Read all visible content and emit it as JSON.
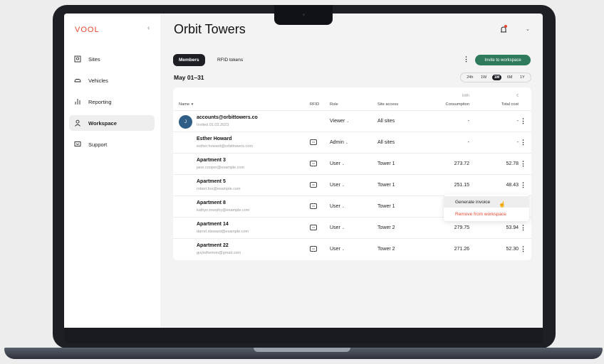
{
  "app": {
    "logo": "VOOL",
    "collapse_icon": "‹"
  },
  "sidebar": {
    "items": [
      {
        "label": "Sites",
        "icon": "map-pin-icon"
      },
      {
        "label": "Vehicles",
        "icon": "car-icon"
      },
      {
        "label": "Reporting",
        "icon": "bar-chart-icon"
      },
      {
        "label": "Workspace",
        "icon": "user-icon",
        "active": true
      },
      {
        "label": "Support",
        "icon": "chat-icon"
      }
    ]
  },
  "header": {
    "title": "Orbit Towers",
    "caret": "⌄"
  },
  "tabs": [
    {
      "label": "Members",
      "active": true
    },
    {
      "label": "RFID tokens",
      "active": false
    }
  ],
  "toolbar": {
    "kebab": "⋮",
    "invite_label": "Invite to workspace"
  },
  "date_range": {
    "label": "May 01–31",
    "options": [
      "24h",
      "1W",
      "1M",
      "6M",
      "1Y"
    ],
    "selected": "1M"
  },
  "table": {
    "headers": {
      "name": "Name",
      "name_sort": "▼",
      "rfid": "RFID",
      "role": "Role",
      "site_access": "Site access",
      "consumption_unit": "kWh",
      "consumption": "Consumption",
      "cost_unit": "€",
      "total_cost": "Total cost"
    },
    "rows": [
      {
        "avatar": "J",
        "name": "accounts@orbittowers.co",
        "email": "Invited 01.03.2023",
        "rfid": "",
        "role": "Viewer",
        "role_chev": "⌄",
        "site": "All sites",
        "consumption": "-",
        "cost": "-",
        "kebab": "⋮"
      },
      {
        "avatar": "",
        "name": "Esther Howard",
        "email": "esther.howard@orbittowers.com",
        "rfid": "RFID",
        "role": "Admin",
        "role_chev": "⌄",
        "site": "All sites",
        "consumption": "-",
        "cost": "-",
        "kebab": "⋮"
      },
      {
        "avatar": "",
        "name": "Apartment 3",
        "email": "jane.cooper@example.com",
        "rfid": "RFID",
        "role": "User",
        "role_chev": "⌄",
        "site": "Tower 1",
        "consumption": "273.72",
        "cost": "52.78",
        "kebab": "⋮"
      },
      {
        "avatar": "",
        "name": "Apartment 5",
        "email": "robert.fox@example.com",
        "rfid": "RFID",
        "role": "User",
        "role_chev": "⌄",
        "site": "Tower 1",
        "consumption": "251.15",
        "cost": "48.43",
        "kebab": "⋮"
      },
      {
        "avatar": "",
        "name": "Apartment 8",
        "email": "kathyn.murphy@example.com",
        "rfid": "RFID",
        "role": "User",
        "role_chev": "⌄",
        "site": "Tower 1",
        "consumption": "",
        "cost": "",
        "kebab": ""
      },
      {
        "avatar": "",
        "name": "Apartment 14",
        "email": "darrel.steward@example.com",
        "rfid": "RFID",
        "role": "User",
        "role_chev": "⌄",
        "site": "Tower 2",
        "consumption": "279.75",
        "cost": "53.94",
        "kebab": "⋮"
      },
      {
        "avatar": "",
        "name": "Apartment 22",
        "email": "guyisthemon@gmail.com",
        "rfid": "RFID",
        "role": "User",
        "role_chev": "⌄",
        "site": "Tower 2",
        "consumption": "271.26",
        "cost": "52.30",
        "kebab": "⋮"
      }
    ]
  },
  "context_menu": {
    "items": [
      "Generate invoice",
      "Remove from workspace"
    ]
  },
  "colors": {
    "accent": "#2f7a5b",
    "brand": "#e8482f",
    "dark": "#1d1f24"
  }
}
